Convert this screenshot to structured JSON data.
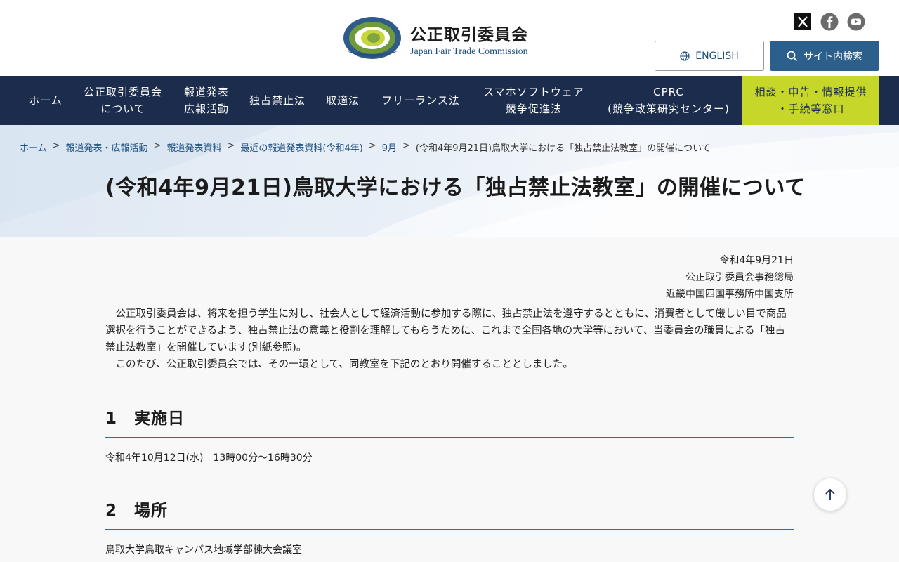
{
  "header": {
    "title": "公正取引委員会",
    "subtitle": "Japan Fair Trade Commission",
    "logo_ring_text": "JAPAN FAIR TRADE COMMISSION",
    "english_label": "ENGLISH",
    "search_label": "サイト内検索",
    "social": [
      "x-icon",
      "facebook-icon",
      "youtube-icon"
    ]
  },
  "nav": {
    "items": [
      {
        "label": "ホーム"
      },
      {
        "label": "公正取引委員会\nについて"
      },
      {
        "label": "報道発表\n広報活動"
      },
      {
        "label": "独占禁止法"
      },
      {
        "label": "取適法"
      },
      {
        "label": "フリーランス法"
      },
      {
        "label": "スマホソフトウェア\n競争促進法"
      },
      {
        "label": "CPRC\n(競争政策研究センター)"
      },
      {
        "label": "相談・申告・情報提供\n・手続等窓口"
      }
    ]
  },
  "breadcrumb": {
    "items": [
      "ホーム",
      "報道発表・広報活動",
      "報道発表資料",
      "最近の報道発表資料(令和4年)",
      "9月"
    ],
    "current": "(令和4年9月21日)鳥取大学における「独占禁止法教室」の開催について",
    "separator": ">"
  },
  "page": {
    "title": "(令和4年9月21日)鳥取大学における「独占禁止法教室」の開催について"
  },
  "content": {
    "date": "令和4年9月21日",
    "org1": "公正取引委員会事務総局",
    "org2": "近畿中国四国事務所中国支所",
    "para1": "　公正取引委員会は、将来を担う学生に対し、社会人として経済活動に参加する際に、独占禁止法を遵守するとともに、消費者として厳しい目で商品選択を行うことができるよう、独占禁止法の意義と役割を理解してもらうために、これまで全国各地の大学等において、当委員会の職員による「独占禁止法教室」を開催しています(別紙参照)。",
    "para2": "　このたび、公正取引委員会では、その一環として、同教室を下記のとおり開催することとしました。",
    "section1_title": "1　実施日",
    "section1_body": "令和4年10月12日(水)　13時00分～16時30分",
    "section2_title": "2　場所",
    "section2_body": "鳥取大学鳥取キャンパス地域学部棟大会議室"
  },
  "colors": {
    "nav_bg": "#1c2c4c",
    "accent": "#c6d72a",
    "link": "#1d4f80",
    "search_btn": "#2c5f8c"
  }
}
